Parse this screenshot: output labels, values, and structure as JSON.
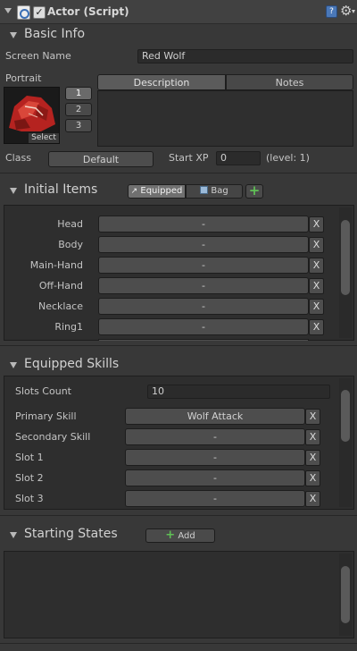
{
  "component": {
    "title": "Actor (Script)",
    "enabled": true
  },
  "basic_info": {
    "title": "Basic Info",
    "screen_name_label": "Screen Name",
    "screen_name_value": "Red Wolf",
    "portrait_label": "Portrait",
    "portrait_select": "Select",
    "portrait_slots": [
      "1",
      "2",
      "3"
    ],
    "tabs": [
      "Description",
      "Notes"
    ],
    "class_label": "Class",
    "class_value": "Default",
    "start_xp_label": "Start XP",
    "start_xp_value": "0",
    "level_text": "(level: 1)"
  },
  "initial_items": {
    "title": "Initial Items",
    "tabs": [
      "Equipped",
      "Bag"
    ],
    "add_label": "+",
    "rows": [
      {
        "label": "Head",
        "value": "-"
      },
      {
        "label": "Body",
        "value": "-"
      },
      {
        "label": "Main-Hand",
        "value": "-"
      },
      {
        "label": "Off-Hand",
        "value": "-"
      },
      {
        "label": "Necklace",
        "value": "-"
      },
      {
        "label": "Ring1",
        "value": "-"
      }
    ],
    "remove_label": "X"
  },
  "equipped_skills": {
    "title": "Equipped Skills",
    "slots_count_label": "Slots Count",
    "slots_count_value": "10",
    "rows": [
      {
        "label": "Primary Skill",
        "value": "Wolf Attack"
      },
      {
        "label": "Secondary Skill",
        "value": "-"
      },
      {
        "label": "Slot 1",
        "value": "-"
      },
      {
        "label": "Slot 2",
        "value": "-"
      },
      {
        "label": "Slot 3",
        "value": "-"
      }
    ],
    "remove_label": "X"
  },
  "starting_states": {
    "title": "Starting States",
    "add_label": "Add"
  },
  "colors": {
    "accent_tab": "#5b5b5b",
    "add_green": "#4caf50"
  }
}
